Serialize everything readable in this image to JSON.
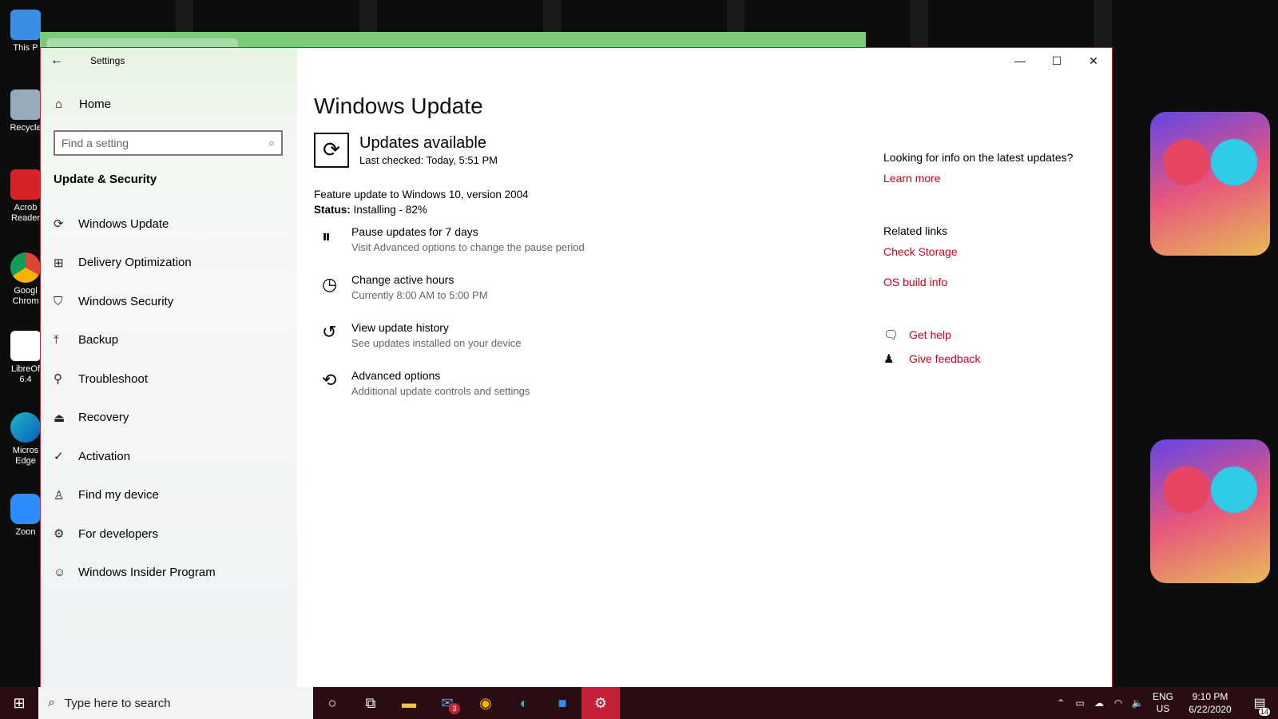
{
  "desktop": {
    "icons": [
      {
        "label": "This P",
        "icon": "computer-icon"
      },
      {
        "label": "Recycle",
        "icon": "recycle-bin-icon"
      },
      {
        "label": "Acrob Reader",
        "icon": "acrobat-icon"
      },
      {
        "label": "Googl Chrom",
        "icon": "chrome-icon"
      },
      {
        "label": "LibreOf 6.4",
        "icon": "libreoffice-icon"
      },
      {
        "label": "Micros Edge",
        "icon": "edge-icon"
      },
      {
        "label": "Zoon",
        "icon": "zoom-icon"
      }
    ]
  },
  "window": {
    "app_title": "Settings",
    "controls": {
      "minimize": "—",
      "maximize": "☐",
      "close": "✕"
    }
  },
  "sidebar": {
    "home_label": "Home",
    "search_placeholder": "Find a setting",
    "section_title": "Update & Security",
    "items": [
      {
        "label": "Windows Update",
        "icon": "sync-icon"
      },
      {
        "label": "Delivery Optimization",
        "icon": "delivery-icon"
      },
      {
        "label": "Windows Security",
        "icon": "shield-icon"
      },
      {
        "label": "Backup",
        "icon": "backup-icon"
      },
      {
        "label": "Troubleshoot",
        "icon": "wrench-icon"
      },
      {
        "label": "Recovery",
        "icon": "recovery-icon"
      },
      {
        "label": "Activation",
        "icon": "check-circle-icon"
      },
      {
        "label": "Find my device",
        "icon": "person-pin-icon"
      },
      {
        "label": "For developers",
        "icon": "developer-icon"
      },
      {
        "label": "Windows Insider Program",
        "icon": "insider-icon"
      }
    ]
  },
  "main": {
    "page_title": "Windows Update",
    "status_heading": "Updates available",
    "last_checked": "Last checked: Today, 5:51 PM",
    "feature_update": "Feature update to Windows 10, version 2004",
    "status_label": "Status:",
    "status_value": "Installing - 82%",
    "install_progress_percent": 82,
    "options": [
      {
        "title": "Pause updates for 7 days",
        "desc": "Visit Advanced options to change the pause period",
        "icon": "pause-icon"
      },
      {
        "title": "Change active hours",
        "desc": "Currently 8:00 AM to 5:00 PM",
        "icon": "active-hours-icon"
      },
      {
        "title": "View update history",
        "desc": "See updates installed on your device",
        "icon": "history-icon"
      },
      {
        "title": "Advanced options",
        "desc": "Additional update controls and settings",
        "icon": "advanced-sync-icon"
      }
    ]
  },
  "right": {
    "question": "Looking for info on the latest updates?",
    "learn_more": "Learn more",
    "related_links": "Related links",
    "check_storage": "Check Storage",
    "os_build_info": "OS build info",
    "get_help": "Get help",
    "give_feedback": "Give feedback",
    "link_color": "#d0021b"
  },
  "taskbar": {
    "search_placeholder": "Type here to search",
    "mail_badge": "3",
    "lang_top": "ENG",
    "lang_bottom": "US",
    "time": "9:10 PM",
    "date": "6/22/2020",
    "notification_count": "14",
    "accent_color": "#c5223a"
  }
}
